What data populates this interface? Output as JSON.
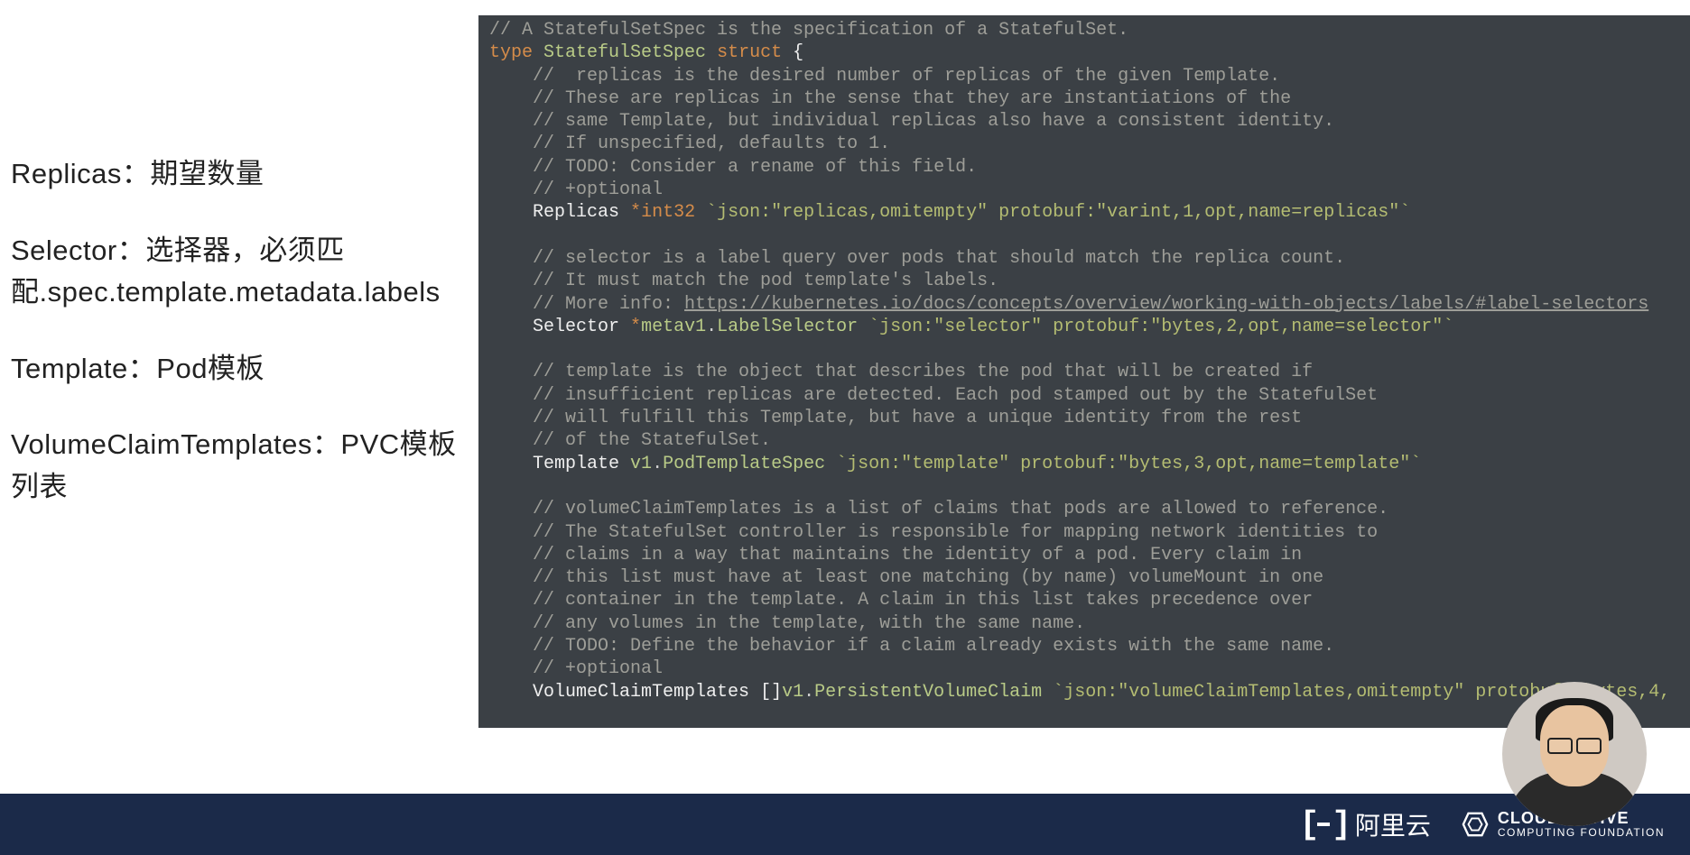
{
  "left": {
    "replicas": "Replicas：期望数量",
    "selector": "Selector：选择器，必须匹配.spec.template.metadata.labels",
    "template": "Template：Pod模板",
    "vct": "VolumeClaimTemplates：PVC模板列表"
  },
  "code": {
    "c0": "// A StatefulSetSpec is the specification of a StatefulSet.",
    "kw_type": "type",
    "name_type": "StatefulSetSpec",
    "kw_struct": "struct",
    "brace_open": "{",
    "c1": "//  replicas is the desired number of replicas of the given Template.",
    "c2": "// These are replicas in the sense that they are instantiations of the",
    "c3": "// same Template, but individual replicas also have a consistent identity.",
    "c4": "// If unspecified, defaults to 1.",
    "c5": "// TODO: Consider a rename of this field.",
    "c6": "// +optional",
    "f_replicas": "Replicas",
    "t_replicas": "int32",
    "tag_replicas": "`json:\"replicas,omitempty\" protobuf:\"varint,1,opt,name=replicas\"`",
    "c7": "// selector is a label query over pods that should match the replica count.",
    "c8": "// It must match the pod template's labels.",
    "c9a": "// More info: ",
    "c9b": "https://kubernetes.io/docs/concepts/overview/working-with-objects/labels/#label-selectors",
    "f_selector": "Selector",
    "star": "*",
    "pkg_metav1": "metav1",
    "dot": ".",
    "t_selector": "LabelSelector",
    "tag_selector": "`json:\"selector\" protobuf:\"bytes,2,opt,name=selector\"`",
    "c10": "// template is the object that describes the pod that will be created if",
    "c11": "// insufficient replicas are detected. Each pod stamped out by the StatefulSet",
    "c12": "// will fulfill this Template, but have a unique identity from the rest",
    "c13": "// of the StatefulSet.",
    "f_template": "Template",
    "pkg_v1": "v1",
    "t_template": "PodTemplateSpec",
    "tag_template": "`json:\"template\" protobuf:\"bytes,3,opt,name=template\"`",
    "c14": "// volumeClaimTemplates is a list of claims that pods are allowed to reference.",
    "c15": "// The StatefulSet controller is responsible for mapping network identities to",
    "c16": "// claims in a way that maintains the identity of a pod. Every claim in",
    "c17": "// this list must have at least one matching (by name) volumeMount in one",
    "c18": "// container in the template. A claim in this list takes precedence over",
    "c19": "// any volumes in the template, with the same name.",
    "c20": "// TODO: Define the behavior if a claim already exists with the same name.",
    "c21": "// +optional",
    "f_vct": "VolumeClaimTemplates",
    "arr": "[]",
    "t_vct": "PersistentVolumeClaim",
    "tag_vct": "`json:\"volumeClaimTemplates,omitempty\" protobuf:\"bytes,4,"
  },
  "footer": {
    "aliyun": "阿里云",
    "cncf_l1": "CLOUD NATIVE",
    "cncf_l2": "COMPUTING FOUNDATION"
  }
}
